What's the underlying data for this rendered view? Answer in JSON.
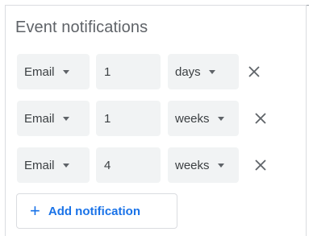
{
  "title": "Event notifications",
  "notifications": [
    {
      "method": "Email",
      "amount": "1",
      "unit": "days"
    },
    {
      "method": "Email",
      "amount": "1",
      "unit": "weeks"
    },
    {
      "method": "Email",
      "amount": "4",
      "unit": "weeks"
    }
  ],
  "add_button": {
    "icon": "+",
    "label": "Add notification"
  },
  "icons": {
    "caret": "chevron-down-icon",
    "remove": "close-icon"
  },
  "colors": {
    "accent": "#1a73e8",
    "field_bg": "#f1f3f4",
    "text": "#3c4043",
    "title": "#5f6368",
    "border": "#dadce0"
  }
}
